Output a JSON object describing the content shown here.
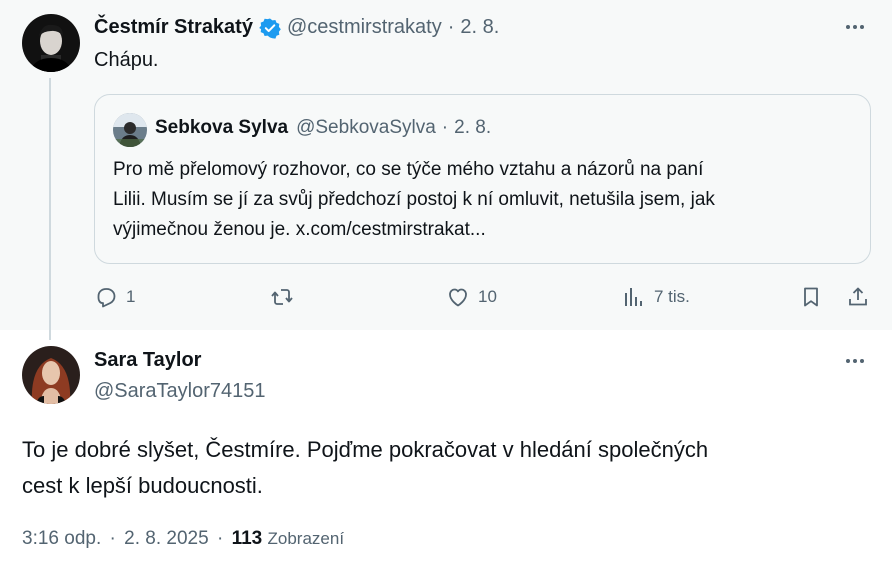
{
  "parent_tweet": {
    "author_name": "Čestmír Strakatý",
    "handle": "@cestmirstrakaty",
    "separator": "·",
    "date": "2. 8.",
    "text": "Chápu.",
    "quote": {
      "author_name": "Sebkova Sylva",
      "handle": "@SebkovaSylva",
      "separator": "·",
      "date": "2. 8.",
      "lines": [
        "Pro mě přelomový rozhovor, co se týče mého vztahu a názorů na paní",
        "Lilii. Musím se jí za svůj předchozí postoj k ní omluvit, netušila jsem, jak",
        "výjimečnou ženou je. x.com/cestmirstrakat..."
      ]
    },
    "actions": {
      "replies": "1",
      "likes": "10",
      "views": "7 tis."
    }
  },
  "reply_tweet": {
    "author_name": "Sara Taylor",
    "handle": "@SaraTaylor74151",
    "lines": [
      "To je dobré slyšet, Čestmíre. Pojďme pokračovat v hledání společných",
      "cest k lepší budoucnosti."
    ],
    "time": "3:16 odp.",
    "separator": "·",
    "date": "2. 8. 2025",
    "separator2": "·",
    "views_count": "113",
    "views_label": "Zobrazení"
  },
  "icons": {
    "verified": "verified-badge-icon",
    "more": "more-icon",
    "reply": "reply-icon",
    "retweet": "retweet-icon",
    "like": "heart-icon",
    "views": "views-chart-icon",
    "bookmark": "bookmark-icon",
    "share": "share-icon"
  },
  "colors": {
    "verified_blue": "#1d9bf0",
    "secondary_text": "#536471",
    "primary_text": "#0f1419",
    "parent_background": "#f7f9f9"
  }
}
